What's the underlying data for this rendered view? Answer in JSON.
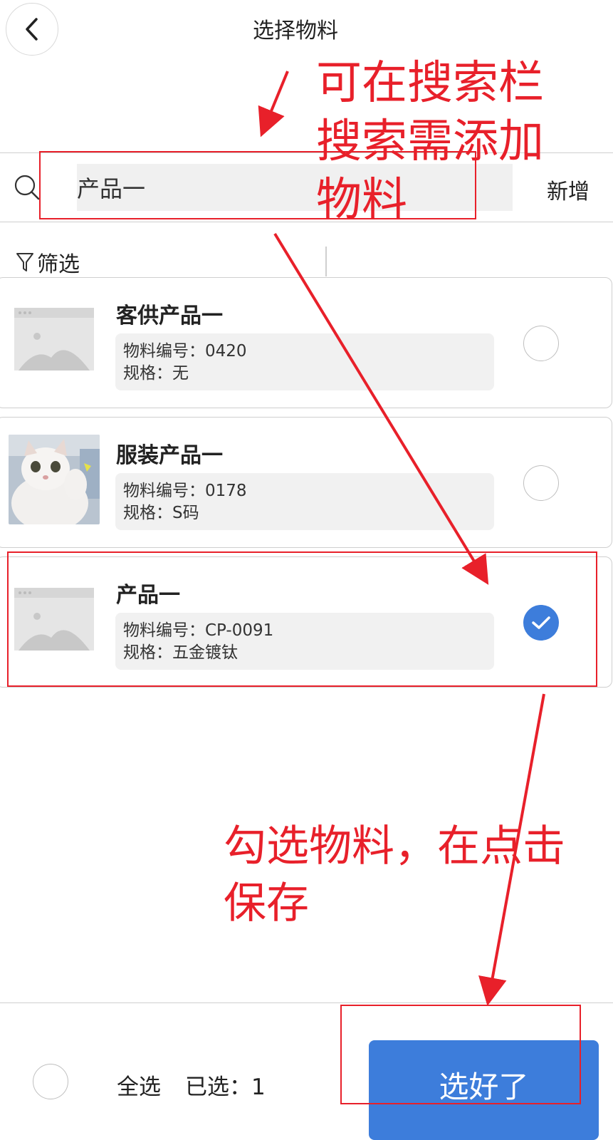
{
  "header": {
    "title": "选择物料"
  },
  "search": {
    "value": "产品一",
    "add_label": "新增"
  },
  "filter": {
    "label": "筛选"
  },
  "items": [
    {
      "name": "客供产品一",
      "code_line": "物料编号：0420",
      "spec_line": "规格：无",
      "thumb": "image-placeholder-icon",
      "selected": false
    },
    {
      "name": "服装产品一",
      "code_line": "物料编号：0178",
      "spec_line": "规格：S码",
      "thumb": "cat-photo",
      "selected": false
    },
    {
      "name": "产品一",
      "code_line": "物料编号：CP-0091",
      "spec_line": "规格：五金镀钛",
      "thumb": "image-placeholder-icon",
      "selected": true
    }
  ],
  "footer": {
    "select_all": "全选",
    "selected_count": "已选：1",
    "confirm": "选好了"
  },
  "annotations": {
    "search_hint": [
      "可在搜索栏",
      "搜索需添加",
      "物料"
    ],
    "select_hint": [
      "勾选物料，在点击",
      "保存"
    ]
  },
  "colors": {
    "accent": "#3d7ddb",
    "annotation": "#e8202a"
  }
}
